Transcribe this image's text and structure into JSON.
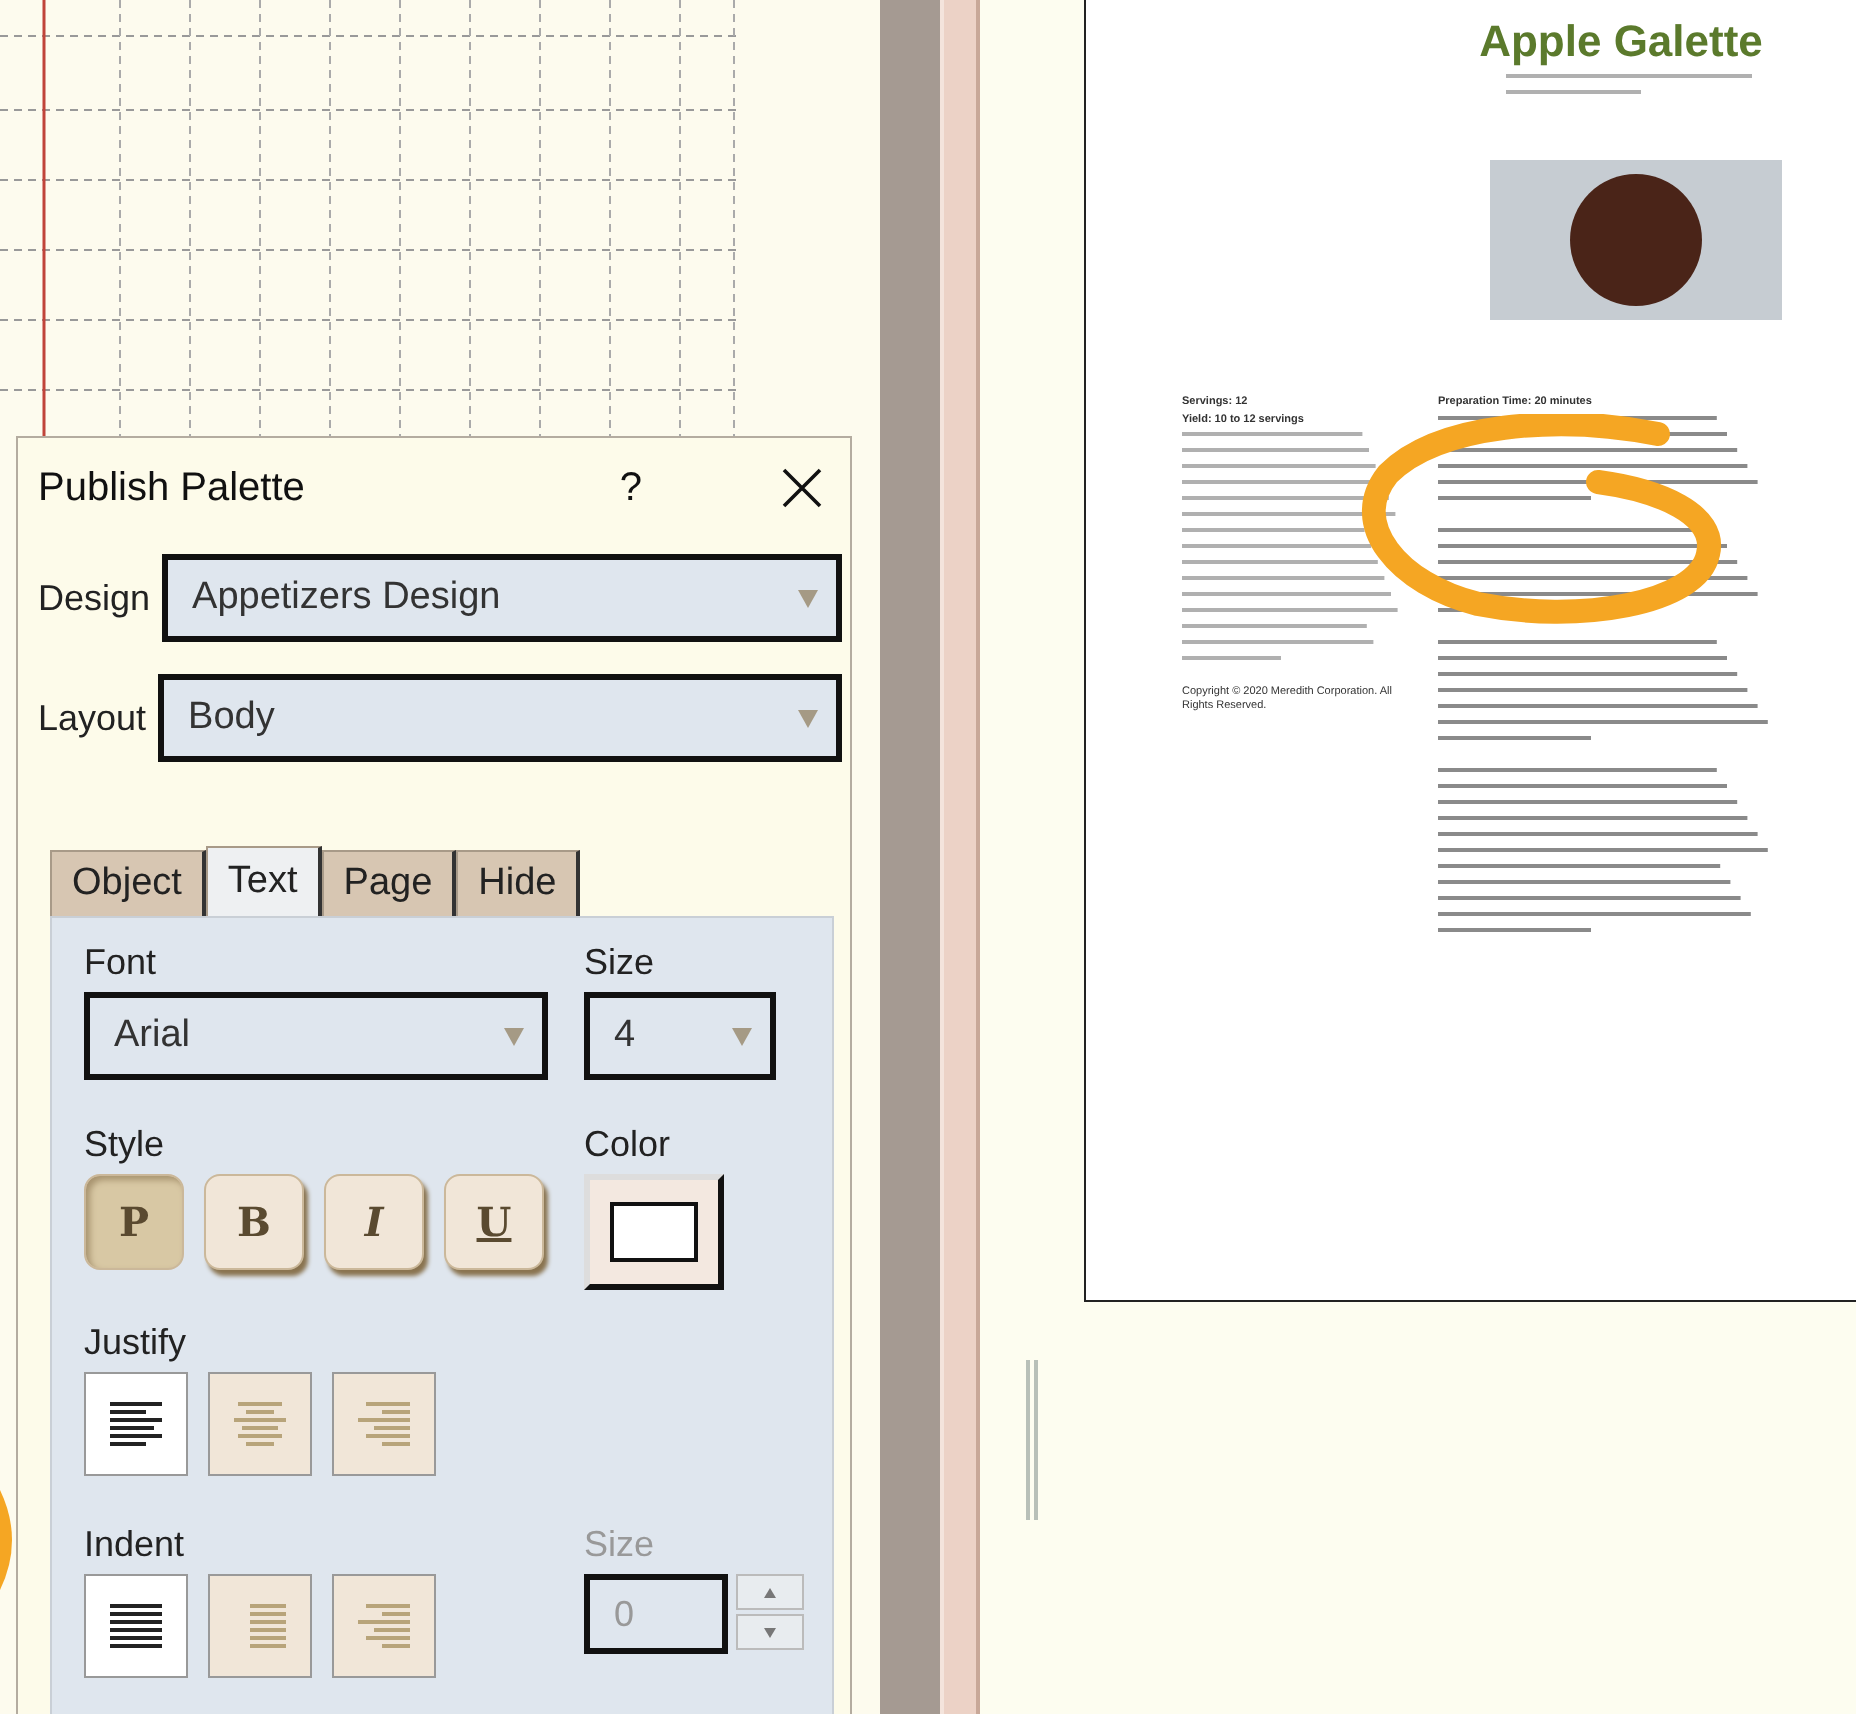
{
  "palette": {
    "title": "Publish Palette",
    "help": "?",
    "design": {
      "label": "Design",
      "value": "Appetizers Design"
    },
    "layout": {
      "label": "Layout",
      "value": "Body"
    },
    "tabs": [
      {
        "label": "Object",
        "selected": false
      },
      {
        "label": "Text",
        "selected": true
      },
      {
        "label": "Page",
        "selected": false
      },
      {
        "label": "Hide",
        "selected": false
      }
    ],
    "font": {
      "label": "Font",
      "value": "Arial"
    },
    "size": {
      "label": "Size",
      "value": "4"
    },
    "style": {
      "label": "Style",
      "buttons": [
        {
          "letter": "P",
          "kind": "plain",
          "selected": true
        },
        {
          "letter": "B",
          "kind": "bold",
          "selected": false
        },
        {
          "letter": "I",
          "kind": "italic",
          "selected": false
        },
        {
          "letter": "U",
          "kind": "underline",
          "selected": false
        }
      ]
    },
    "color": {
      "label": "Color"
    },
    "justify": {
      "label": "Justify",
      "options": [
        {
          "kind": "left",
          "selected": true
        },
        {
          "kind": "center",
          "selected": false
        },
        {
          "kind": "right",
          "selected": false
        }
      ]
    },
    "indent": {
      "label": "Indent",
      "options": [
        {
          "kind": "none",
          "selected": true
        },
        {
          "kind": "hanging",
          "selected": false
        },
        {
          "kind": "right",
          "selected": false
        }
      ],
      "size_label": "Size",
      "size_value": "0",
      "disabled": true
    }
  },
  "document": {
    "title": "Apple Galette",
    "servings": "Servings: 12",
    "yield": "Yield: 10 to 12 servings",
    "prep": "Preparation Time: 20 minutes",
    "copyright": "Copyright © 2020 Meredith Corporation. All Rights Reserved."
  }
}
